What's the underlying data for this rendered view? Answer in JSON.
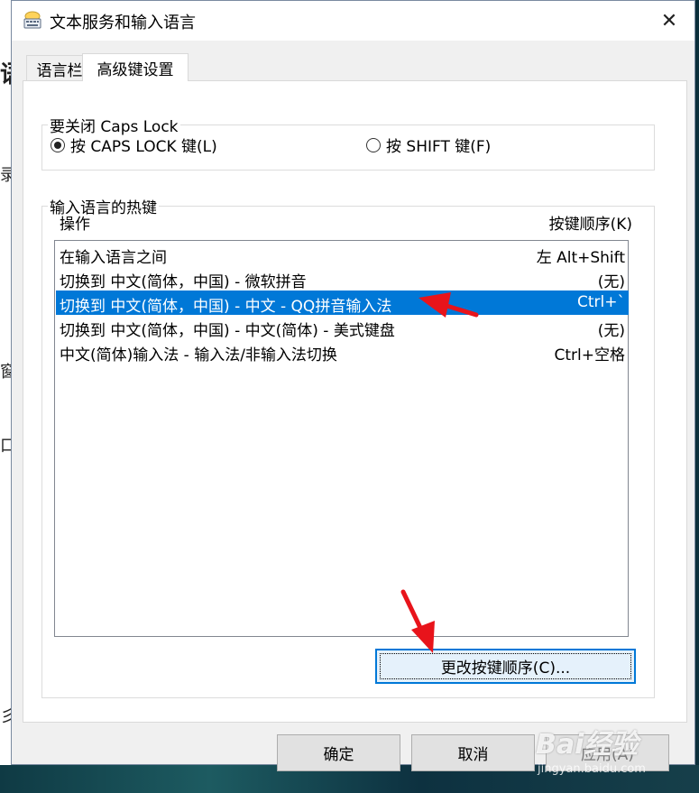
{
  "window": {
    "title": "文本服务和输入语言",
    "icon": "keyboard-icon",
    "close_glyph": "✕"
  },
  "tabs": [
    {
      "label": "语言栏"
    },
    {
      "label": "高级键设置"
    }
  ],
  "caps_lock": {
    "legend": "要关闭 Caps Lock",
    "options": [
      {
        "label": "按 CAPS LOCK 键(L)",
        "selected": true
      },
      {
        "label": "按 SHIFT 键(F)",
        "selected": false
      }
    ]
  },
  "hotkeys": {
    "legend": "输入语言的热键",
    "col_action": "操作",
    "col_sequence": "按键顺序(K)",
    "rows": [
      {
        "action": "在输入语言之间",
        "sequence": "左 Alt+Shift",
        "selected": false
      },
      {
        "action": "切换到 中文(简体，中国) - 微软拼音",
        "sequence": "(无)",
        "selected": false
      },
      {
        "action": "切换到 中文(简体，中国) - 中文 - QQ拼音输入法",
        "sequence": "Ctrl+`",
        "selected": true
      },
      {
        "action": "切换到 中文(简体，中国) - 中文(简体) - 美式键盘",
        "sequence": "(无)",
        "selected": false
      },
      {
        "action": "中文(简体)输入法 - 输入法/非输入法切换",
        "sequence": "Ctrl+空格",
        "selected": false
      }
    ],
    "change_button": "更改按键顺序(C)..."
  },
  "footer": {
    "ok": "确定",
    "cancel": "取消",
    "apply": "应用(A)"
  },
  "watermark": {
    "brand": "Bai经验",
    "url": "jingyan.baidu.com"
  },
  "colors": {
    "selection": "#0078d7",
    "annotation_arrow": "#e8141b"
  },
  "background_fragments": [
    "语",
    "录",
    "窗",
    "口",
    "彡"
  ]
}
